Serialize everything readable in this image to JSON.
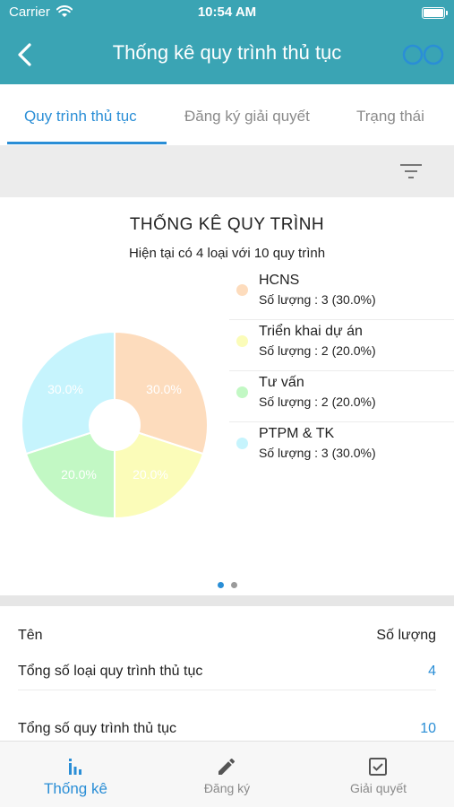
{
  "status_bar": {
    "carrier": "Carrier",
    "time": "10:54 AM"
  },
  "header": {
    "title": "Thống kê quy trình thủ tục",
    "back_icon": "chevron-left-icon",
    "action_icon": "rings-icon"
  },
  "tabs": [
    {
      "label": "Quy trình thủ tục",
      "active": true
    },
    {
      "label": "Đăng ký giải quyết",
      "active": false
    },
    {
      "label": "Trạng thái",
      "active": false
    }
  ],
  "toolbar": {
    "filter_icon": "filter-icon"
  },
  "chart": {
    "title": "THỐNG KÊ QUY TRÌNH",
    "subtitle": "Hiện tại có 4 loại với 10 quy trình",
    "legend": [
      {
        "name": "HCNS",
        "count_text": "Số lượng : 3 (30.0%)",
        "color": "#fddcbd"
      },
      {
        "name": "Triển khai dự án",
        "count_text": "Số lượng : 2 (20.0%)",
        "color": "#fbfcb9"
      },
      {
        "name": "Tư vấn",
        "count_text": "Số lượng : 2 (20.0%)",
        "color": "#c2f8c4"
      },
      {
        "name": "PTPM & TK",
        "count_text": "Số lượng : 3 (30.0%)",
        "color": "#c6f4fd"
      }
    ],
    "pager": {
      "total": 2,
      "current": 1
    }
  },
  "chart_data": {
    "type": "pie",
    "title": "THỐNG KÊ QUY TRÌNH",
    "subtitle": "Hiện tại có 4 loại với 10 quy trình",
    "categories": [
      "HCNS",
      "Triển khai dự án",
      "Tư vấn",
      "PTPM & TK"
    ],
    "values": [
      3,
      2,
      2,
      3
    ],
    "labels": [
      "30.0%",
      "20.0%",
      "20.0%",
      "30.0%"
    ],
    "colors": [
      "#fddcbd",
      "#fbfcb9",
      "#c2f8c4",
      "#c6f4fd"
    ],
    "donut": true,
    "legend_position": "right"
  },
  "table": {
    "header": {
      "name": "Tên",
      "value": "Số lượng"
    },
    "rows": [
      {
        "name": "Tổng số loại quy trình thủ tục",
        "value": "4"
      },
      {
        "name": "Tổng số quy trình thủ tục",
        "value": "10"
      }
    ]
  },
  "tabbar": [
    {
      "label": "Thống kê",
      "icon": "bar-chart-icon",
      "active": true
    },
    {
      "label": "Đăng ký",
      "icon": "pencil-icon",
      "active": false
    },
    {
      "label": "Giải quyết",
      "icon": "checkbox-icon",
      "active": false
    }
  ]
}
